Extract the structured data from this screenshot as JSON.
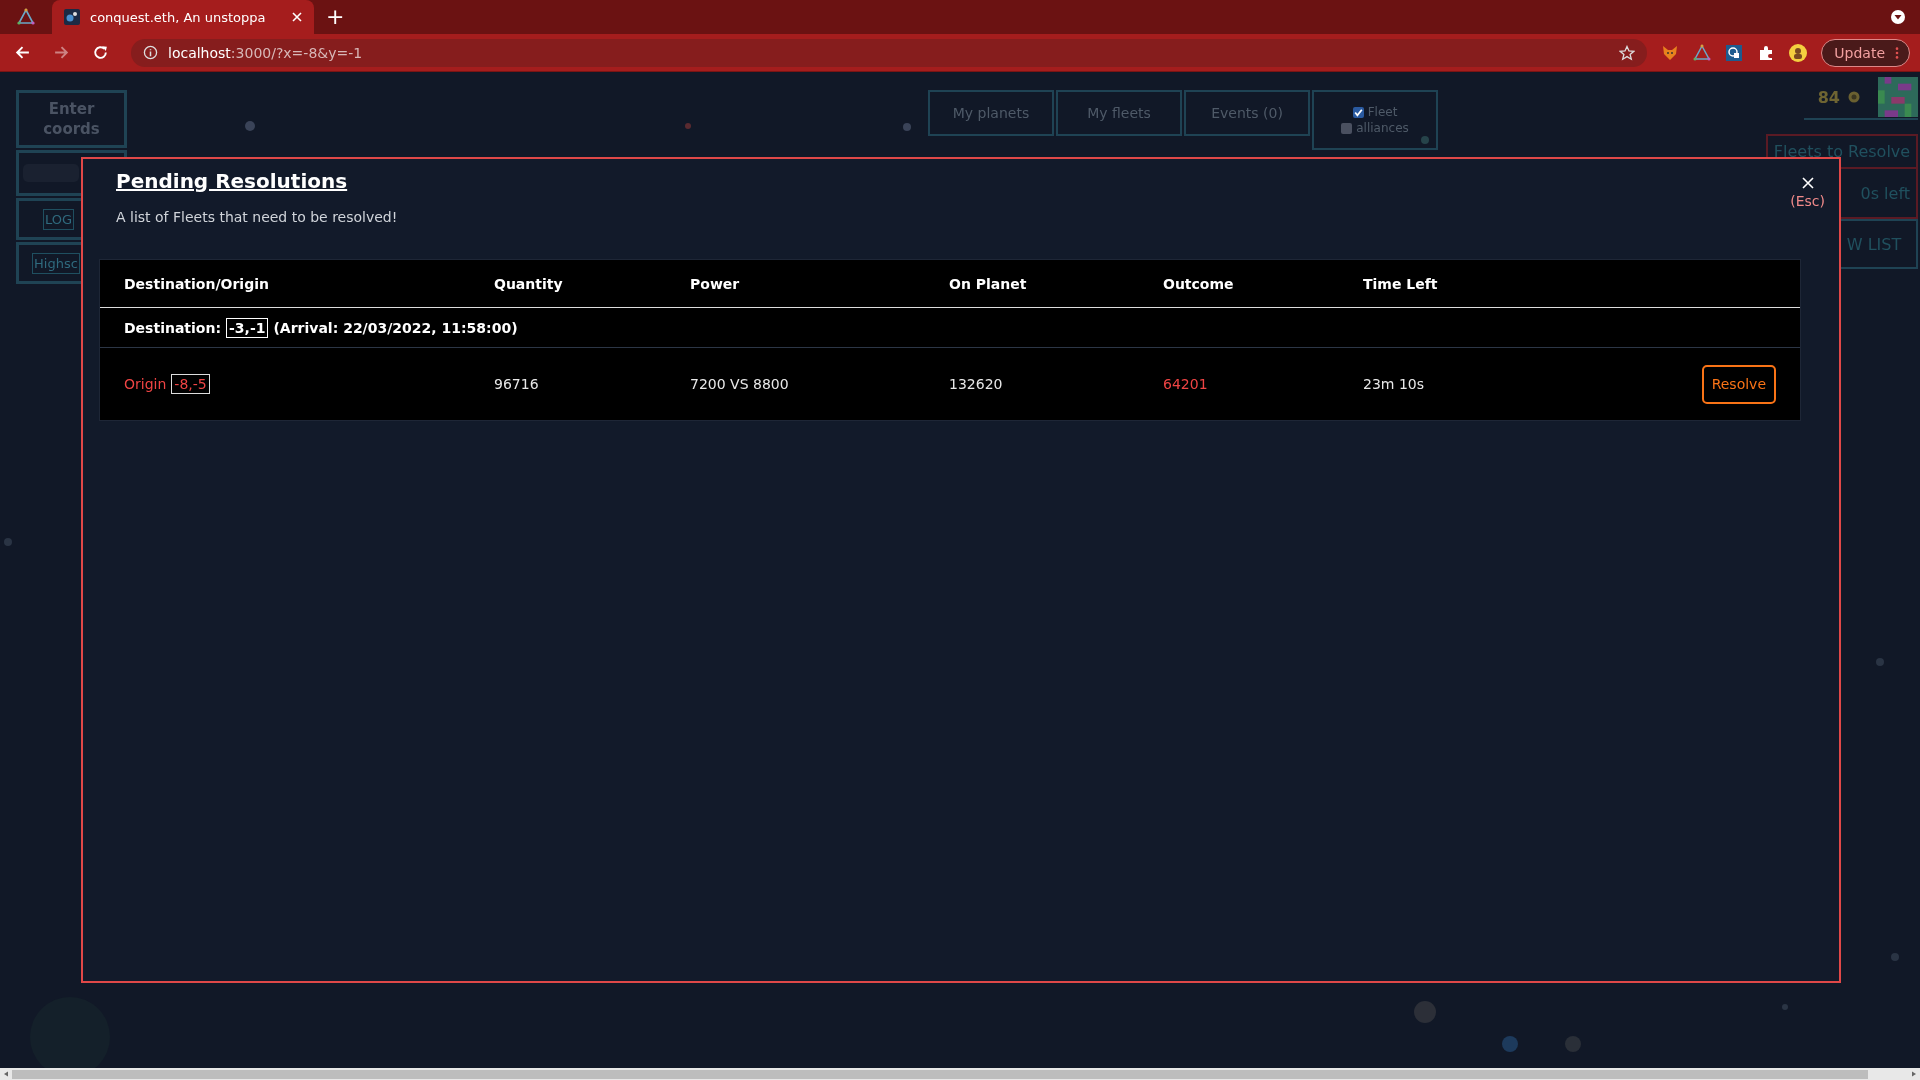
{
  "browser": {
    "tabs": [
      {
        "title": "conquest.eth, An unstoppa",
        "selected": true
      }
    ],
    "new_tab": "+",
    "url_host": "localhost",
    "url_path": ":3000/?x=-8&y=-1",
    "forward_disabled": true,
    "update_button": "Update"
  },
  "hud": {
    "left_panel": {
      "coords_button": "Enter coords",
      "login_button": "LOG",
      "highscores_button": "Highsc"
    },
    "nav_buttons": [
      "My planets",
      "My fleets",
      "Events (0)"
    ],
    "filters": [
      {
        "label": "Fleet",
        "checked": true
      },
      {
        "label": "alliances",
        "checked": false
      }
    ],
    "score": "84",
    "fleets_to_resolve": "Fleets to Resolve",
    "time_left": "0s left",
    "list_button": "W LIST"
  },
  "modal": {
    "title": "Pending Resolutions",
    "subtitle": "A list of Fleets that need to be resolved!",
    "close_hint": "(Esc)",
    "columns": [
      "Destination/Origin",
      "Quantity",
      "Power",
      "On Planet",
      "Outcome",
      "Time Left"
    ],
    "groups": [
      {
        "destination_label": "Destination:",
        "coords": "-3,-1",
        "arrival": "(Arrival: 22/03/2022, 11:58:00)",
        "rows": [
          {
            "origin_label": "Origin",
            "origin_coords": "-8,-5",
            "quantity": "96716",
            "power": "7200 VS 8800",
            "on_planet": "132620",
            "outcome": "64201",
            "time_left": "23m 10s",
            "action": "Resolve"
          }
        ]
      }
    ]
  }
}
